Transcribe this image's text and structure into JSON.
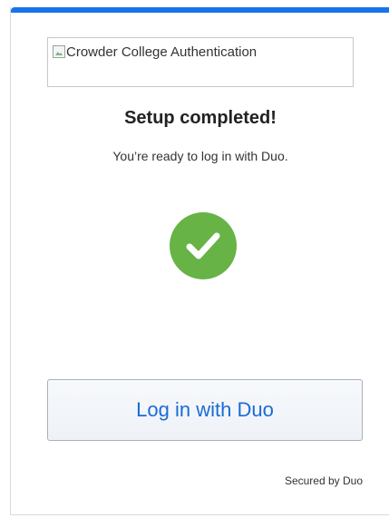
{
  "logo": {
    "alt_text": "Crowder College Authentication"
  },
  "heading": "Setup completed!",
  "message": "You’re ready to log in with Duo.",
  "status_icon": "check-circle-icon",
  "colors": {
    "accent": "#1a73e8",
    "success": "#67b346",
    "link": "#1a6bd6"
  },
  "login_button_label": "Log in with Duo",
  "footer": {
    "secured_text": "Secured by Duo"
  }
}
